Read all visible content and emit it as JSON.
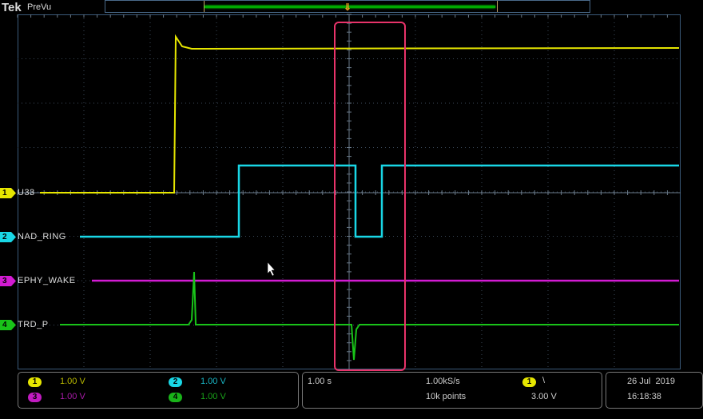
{
  "header": {
    "brand": "Tek",
    "mode": "PreVu"
  },
  "channels": [
    {
      "num": "1",
      "name": "U33",
      "scale": "1.00 V",
      "color": "#e6e600"
    },
    {
      "num": "2",
      "name": "NAD_RING",
      "scale": "1.00 V",
      "color": "#19d7e6"
    },
    {
      "num": "3",
      "name": "EPHY_WAKE",
      "scale": "1.00 V",
      "color": "#d21bd2"
    },
    {
      "num": "4",
      "name": "TRD_P",
      "scale": "1.00 V",
      "color": "#19c319"
    }
  ],
  "horizontal": {
    "scale": "1.00 s",
    "sample_rate": "1.00kS/s",
    "record_length": "10k points"
  },
  "trigger": {
    "source": "1",
    "slope": "\\",
    "level": "3.00 V"
  },
  "datetime": {
    "date": "26 Jul  2019",
    "time": "16:18:38"
  },
  "colors": {
    "highlight": "#e8336a",
    "trigger_marker": "#f0a020"
  }
}
